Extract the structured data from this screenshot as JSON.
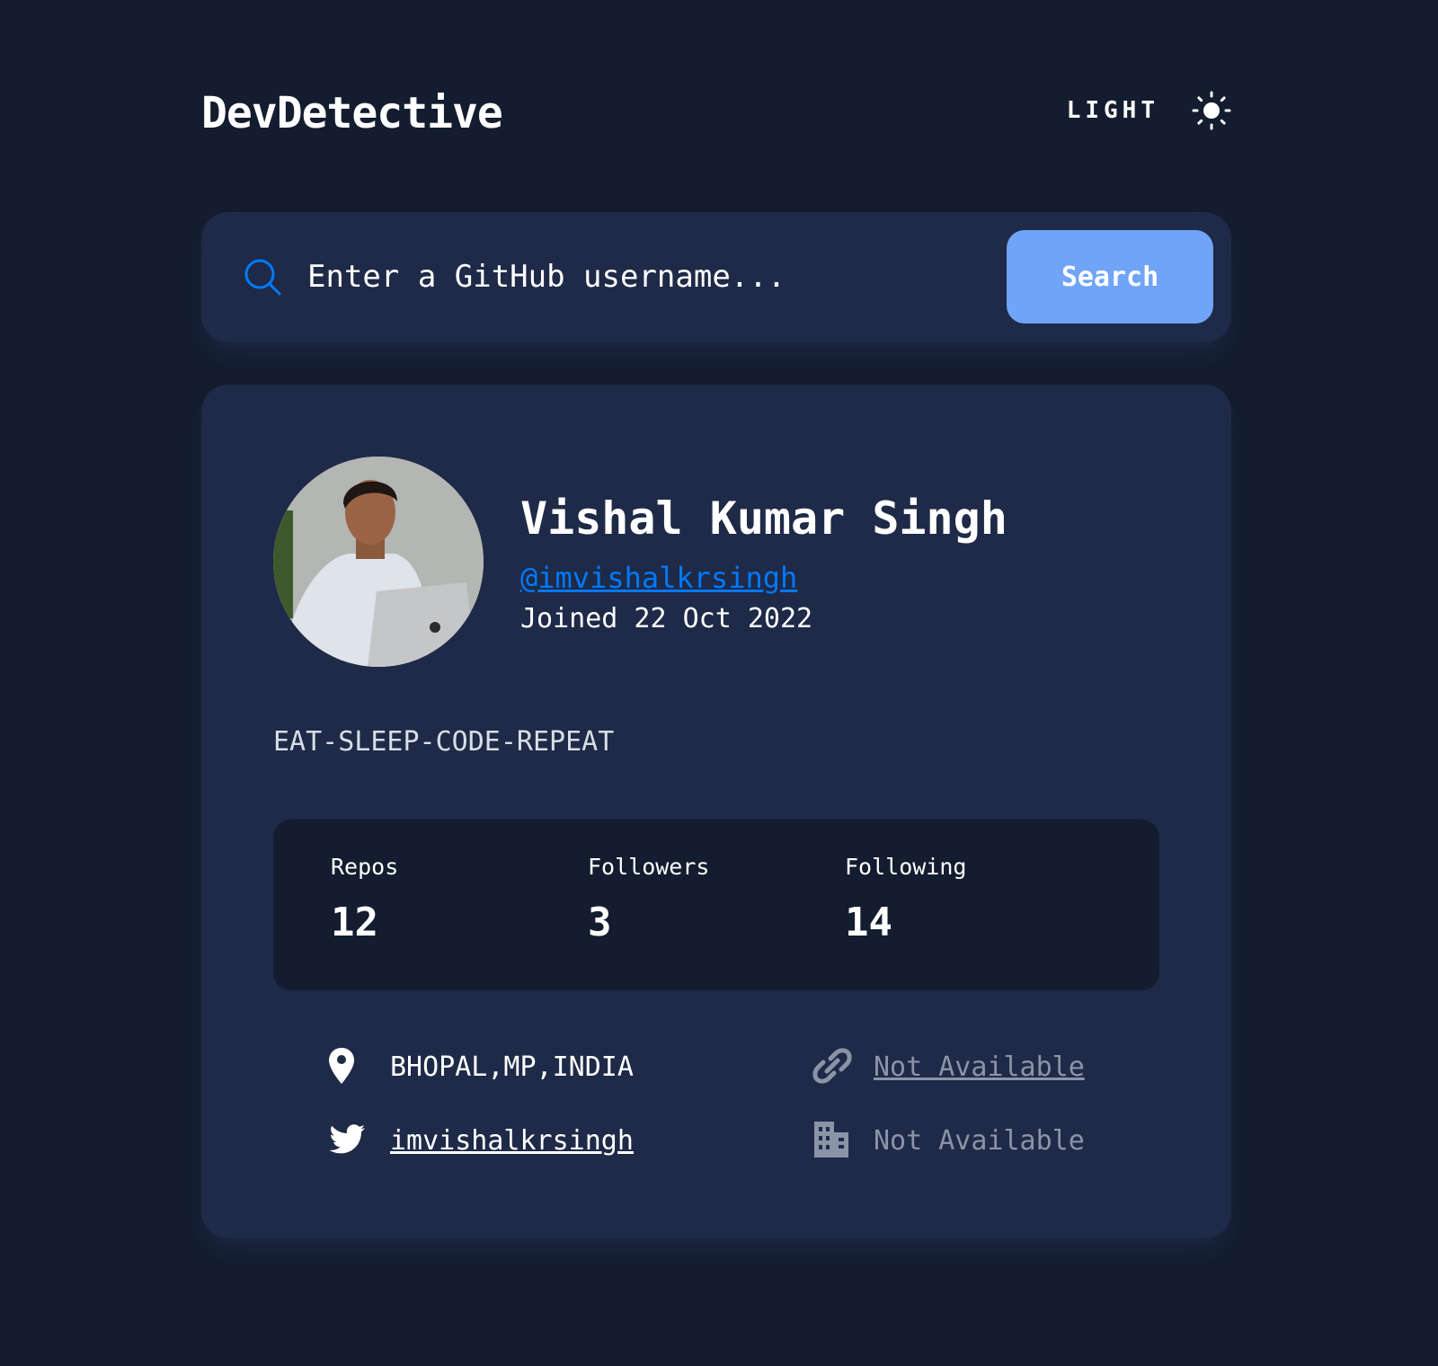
{
  "app": {
    "logo": "DevDetective",
    "theme_toggle_label": "LIGHT",
    "theme_icon": "sun-icon"
  },
  "search": {
    "placeholder": "Enter a GitHub username...",
    "value": "",
    "button_label": "Search",
    "icon": "search-icon"
  },
  "profile": {
    "name": "Vishal Kumar Singh",
    "handle": "@imvishalkrsingh",
    "joined": "Joined 22 Oct 2022",
    "bio": "EAT-SLEEP-CODE-REPEAT",
    "avatar_alt": "avatar"
  },
  "stats": [
    {
      "label": "Repos",
      "value": "12"
    },
    {
      "label": "Followers",
      "value": "3"
    },
    {
      "label": "Following",
      "value": "14"
    }
  ],
  "links": {
    "location": {
      "icon": "location-pin-icon",
      "text": "BHOPAL,MP,INDIA"
    },
    "website": {
      "icon": "link-icon",
      "text": "Not Available"
    },
    "twitter": {
      "icon": "twitter-icon",
      "text": "imvishalkrsingh"
    },
    "company": {
      "icon": "building-icon",
      "text": "Not Available"
    }
  },
  "colors": {
    "background": "#141d2f",
    "card": "#1e2a47",
    "accent": "#0079ff",
    "button": "#6fa4f6",
    "muted": "#8b94a7"
  }
}
